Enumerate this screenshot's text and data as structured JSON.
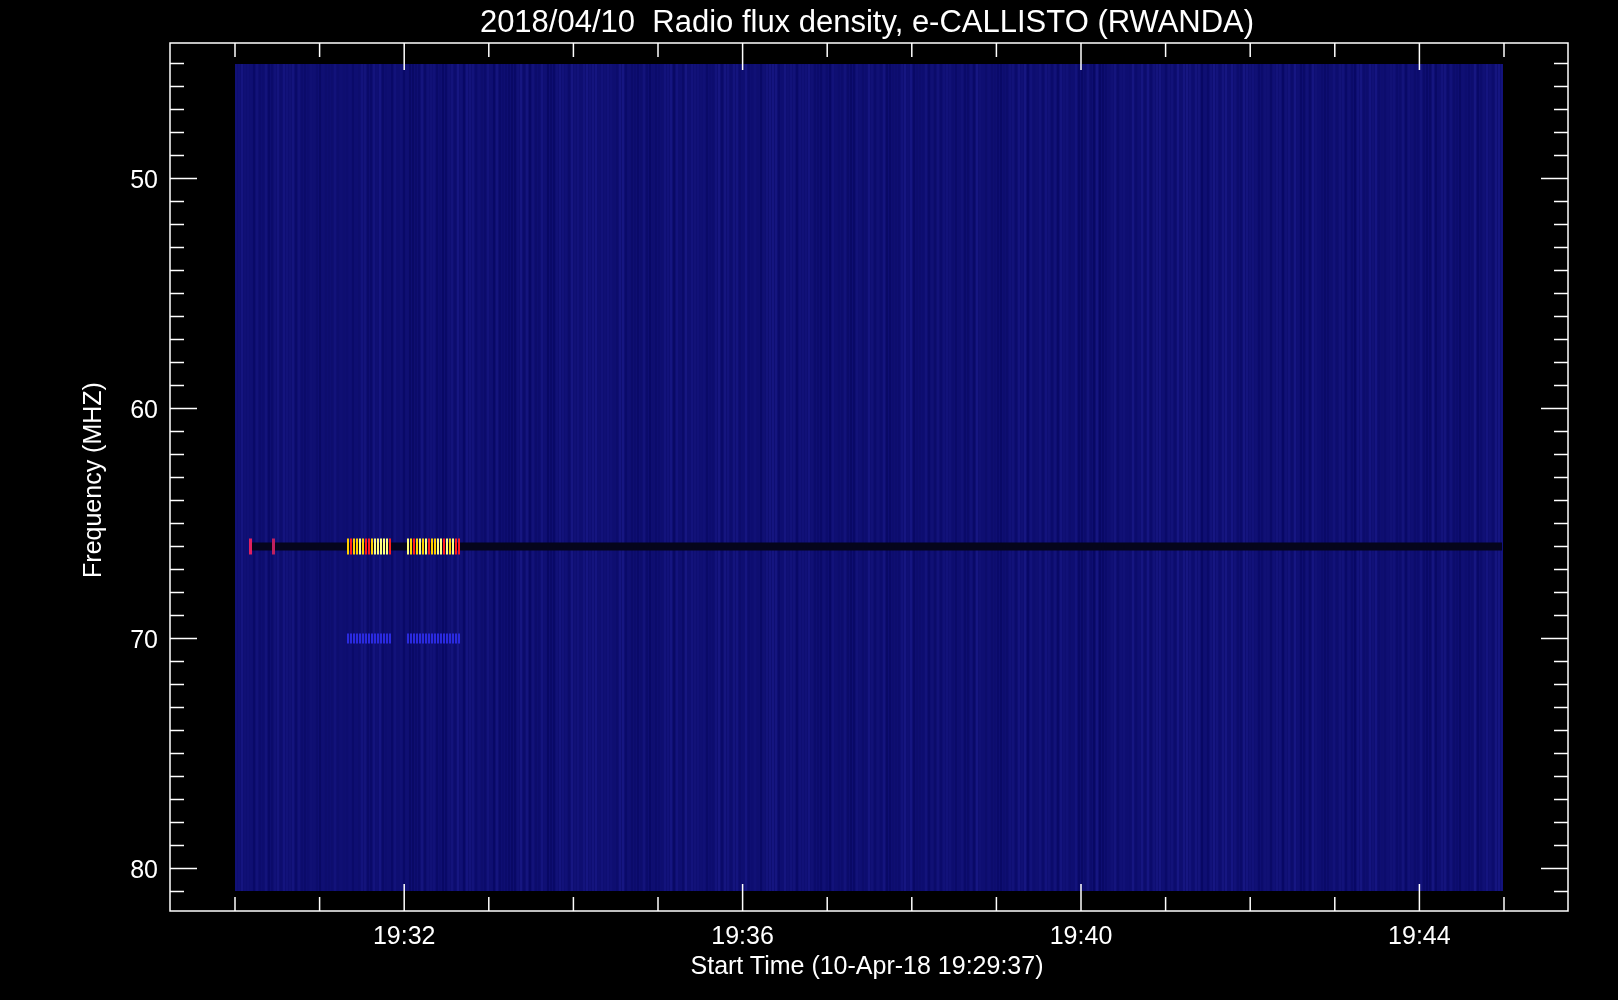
{
  "title": "2018/04/10  Radio flux density, e-CALLISTO (RWANDA)",
  "ylabel": "Frequency (MHZ)",
  "yticks": [
    "50",
    "60",
    "70",
    "80"
  ],
  "xticks": [
    "19:32",
    "19:36",
    "19:40",
    "19:44"
  ],
  "xlabel": "Start Time (10-Apr-18 19:29:37)"
}
